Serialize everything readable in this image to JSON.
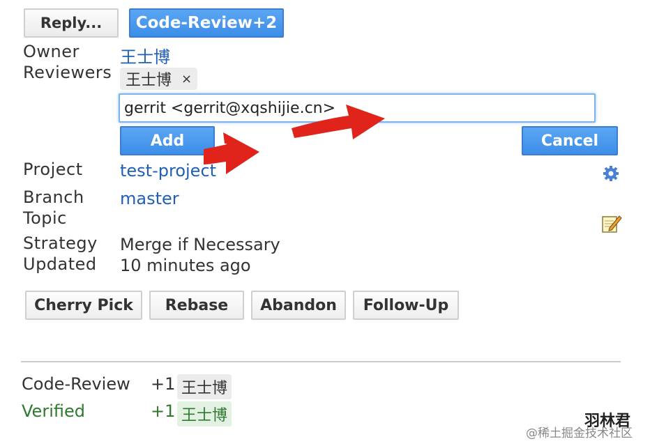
{
  "toolbar": {
    "reply_label": "Reply...",
    "code_review_label": "Code-Review+2"
  },
  "info": {
    "owner_label": "Owner",
    "owner_value": "王士博",
    "reviewers_label": "Reviewers",
    "reviewer_chip": "王士博",
    "reviewer_remove": "×",
    "reviewer_input_value": "gerrit <gerrit@xqshijie.cn>",
    "add_label": "Add",
    "cancel_label": "Cancel",
    "project_label": "Project",
    "project_value": "test-project",
    "branch_label": "Branch",
    "branch_value": "master",
    "topic_label": "Topic",
    "strategy_label": "Strategy",
    "strategy_value": "Merge if Necessary",
    "updated_label": "Updated",
    "updated_value": "10 minutes ago"
  },
  "actions": {
    "cherry_pick": "Cherry Pick",
    "rebase": "Rebase",
    "abandon": "Abandon",
    "follow_up": "Follow-Up"
  },
  "labels": [
    {
      "name": "Code-Review",
      "score": "+1",
      "user": "王士博",
      "color": "#333333"
    },
    {
      "name": "Verified",
      "score": "+1",
      "user": "王士博",
      "color": "#2f7a2f"
    }
  ],
  "watermark": {
    "author": "羽林君",
    "site": "@稀土掘金技术社区"
  },
  "colors": {
    "accent_blue": "#3d8ee8",
    "link": "#1f5fb8",
    "arrow_red": "#e0241b"
  }
}
